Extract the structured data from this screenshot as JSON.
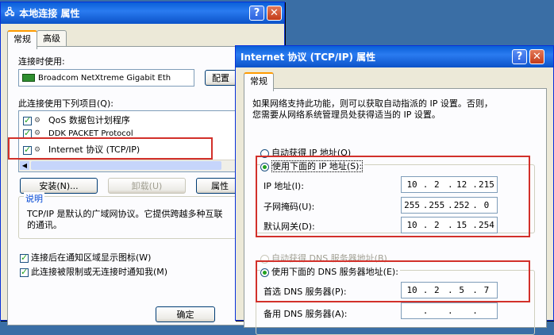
{
  "back_window": {
    "title": "本地连接 属性",
    "tabs": [
      "常规",
      "高级"
    ],
    "connect_using_label": "连接时使用:",
    "adapter": "Broadcom NetXtreme Gigabit Eth",
    "configure_button": "配置",
    "items_label": "此连接使用下列项目(Q):",
    "items": [
      {
        "label": "QoS 数据包计划程序",
        "checked": true
      },
      {
        "label": "DDK PACKET Protocol",
        "checked": true
      },
      {
        "label": "Internet 协议 (TCP/IP)",
        "checked": true
      }
    ],
    "install_button": "安装(N)...",
    "uninstall_button": "卸载(U)",
    "properties_button": "属性",
    "description_title": "说明",
    "description_text_1": "TCP/IP 是默认的广域网协议。它提供跨越多种互联",
    "description_text_2": "的通讯。",
    "check_show_icon": "连接后在通知区域显示图标(W)",
    "check_notify": "此连接被限制或无连接时通知我(M)",
    "ok_button": "确定"
  },
  "front_window": {
    "title": "Internet 协议 (TCP/IP) 属性",
    "tab": "常规",
    "intro_1": "如果网络支持此功能，则可以获取自动指派的 IP 设置。否则，",
    "intro_2": "您需要从网络系统管理员处获得适当的 IP 设置。",
    "radio_auto_ip": "自动获得 IP 地址(O)",
    "radio_manual_ip": "使用下面的 IP 地址(S):",
    "ip_label": "IP 地址(I):",
    "ip_value": [
      "10",
      "2",
      "12",
      "215"
    ],
    "mask_label": "子网掩码(U):",
    "mask_value": [
      "255",
      "255",
      "252",
      "0"
    ],
    "gateway_label": "默认网关(D):",
    "gateway_value": [
      "10",
      "2",
      "15",
      "254"
    ],
    "radio_auto_dns": "自动获得 DNS 服务器地址(B)",
    "radio_manual_dns": "使用下面的 DNS 服务器地址(E):",
    "dns1_label": "首选 DNS 服务器(P):",
    "dns1_value": [
      "10",
      "2",
      "5",
      "7"
    ],
    "dns2_label": "备用 DNS 服务器(A):"
  },
  "colors": {
    "highlight": "#d2302a",
    "titlebar": "#0a5fd8"
  }
}
